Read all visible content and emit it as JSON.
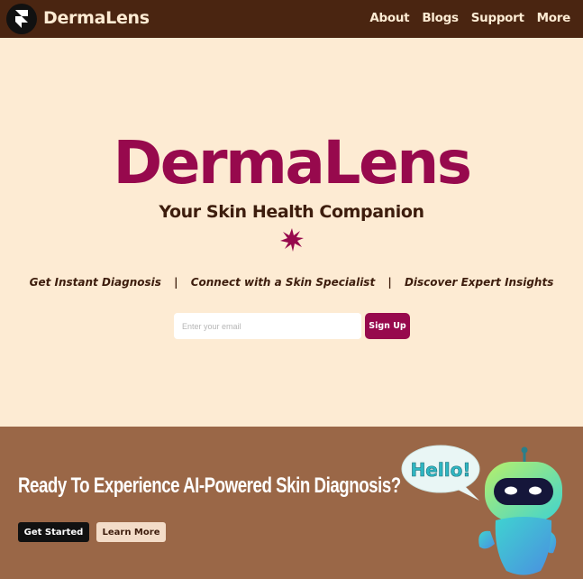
{
  "nav": {
    "brand": "DermaLens",
    "links": [
      "About",
      "Blogs",
      "Support",
      "More"
    ]
  },
  "hero": {
    "title": "DermaLens",
    "subtitle": "Your Skin Health Companion",
    "features": [
      "Get Instant Diagnosis",
      "Connect with a Skin Specialist",
      "Discover Expert Insights"
    ],
    "separator": "|",
    "email_placeholder": "Enter your email",
    "signup_label": "Sign Up"
  },
  "cta": {
    "title": "Ready To Experience AI-Powered Skin Diagnosis?",
    "get_started_label": "Get Started",
    "learn_more_label": "Learn More",
    "bubble_text": "Hello!"
  },
  "colors": {
    "nav_bg": "#4a2511",
    "hero_bg": "#fdebd3",
    "accent": "#97094d",
    "cta_bg": "#9a6747"
  }
}
